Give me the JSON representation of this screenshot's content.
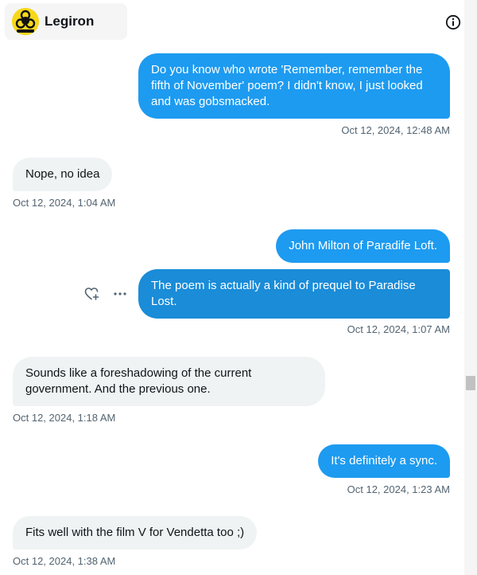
{
  "header": {
    "title": "Legiron",
    "avatar_icon": "biohazard-icon",
    "info_icon": "info-icon"
  },
  "colors": {
    "outgoing_bubble": "#1d9bf0",
    "incoming_bubble": "#eff3f4",
    "timestamp": "#536471",
    "avatar_bg": "#f7d81a"
  },
  "messages": [
    {
      "direction": "outgoing",
      "text": "Do you know who wrote 'Remember, remember the fifth of November' poem? I didn't know, I just looked and was gobsmacked.",
      "time": "Oct 12, 2024, 12:48 AM"
    },
    {
      "direction": "incoming",
      "text": "Nope, no idea",
      "time": "Oct 12, 2024, 1:04 AM"
    },
    {
      "direction": "outgoing",
      "text": "John Milton of Paradife Loft."
    },
    {
      "direction": "outgoing",
      "text": "The poem is actually a kind of prequel to Paradise Lost.",
      "time": "Oct 12, 2024, 1:07 AM"
    },
    {
      "direction": "incoming",
      "text": "Sounds like a foreshadowing of the current government. And the previous one.",
      "time": "Oct 12, 2024, 1:18 AM"
    },
    {
      "direction": "outgoing",
      "text": "It's definitely a sync.",
      "time": "Oct 12, 2024, 1:23 AM"
    },
    {
      "direction": "incoming",
      "text": "Fits well with the film V for Vendetta too ;)",
      "time": "Oct 12, 2024, 1:38 AM"
    }
  ],
  "hover_actions": {
    "react_icon": "heart-plus-icon",
    "more_icon": "more-horizontal-icon"
  }
}
